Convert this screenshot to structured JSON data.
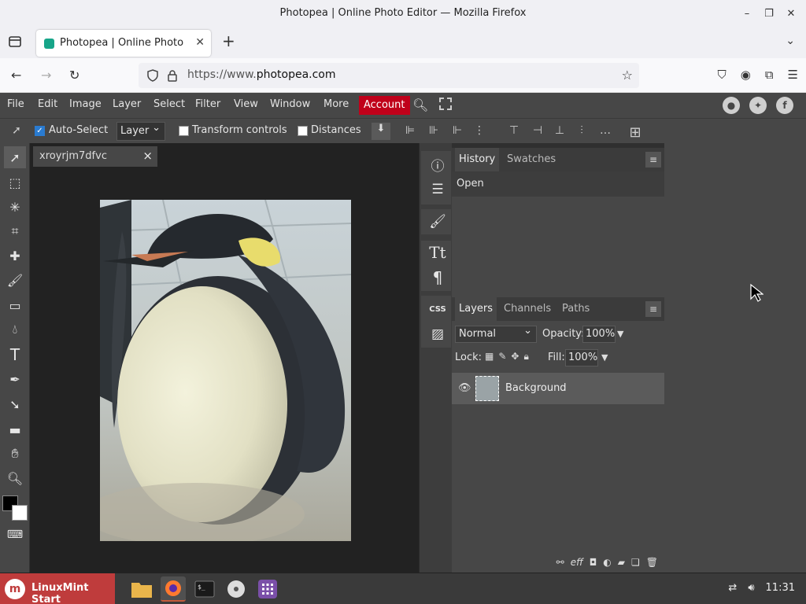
{
  "window": {
    "title": "Photopea | Online Photo Editor — Mozilla Firefox",
    "min_icon": "minimize-icon",
    "max_icon": "restore-icon",
    "close_icon": "close-icon"
  },
  "browser": {
    "tab_title": "Photopea | Online Photo Editor",
    "new_tab_glyph": "+",
    "url_prefix": "https://www.",
    "url_domain": "photopea.com"
  },
  "menu": {
    "items": [
      "File",
      "Edit",
      "Image",
      "Layer",
      "Select",
      "Filter",
      "View",
      "Window",
      "More"
    ],
    "account": "Account"
  },
  "options": {
    "auto_select": "Auto-Select",
    "layer_select": "Layer",
    "transform_controls": "Transform controls",
    "distances": "Distances"
  },
  "document": {
    "tab_name": "xroyrjm7dfvc",
    "close_glyph": "×"
  },
  "side_strip": {
    "css_label": "CSS"
  },
  "history_panel": {
    "tabs": [
      "History",
      "Swatches"
    ],
    "entries": [
      "Open"
    ],
    "menu_glyph": "≡"
  },
  "layers_panel": {
    "tabs": [
      "Layers",
      "Channels",
      "Paths"
    ],
    "blend_mode": "Normal",
    "opacity_label": "Opacity:",
    "opacity_value": "100%",
    "lock_label": "Lock:",
    "fill_label": "Fill:",
    "fill_value": "100%",
    "layers": [
      {
        "name": "Background"
      }
    ],
    "menu_glyph": "≡"
  },
  "taskbar": {
    "start_label": "LinuxMint Start",
    "time": "11:31"
  },
  "colors": {
    "accent_account": "#c0001a",
    "panel": "#474747",
    "workspace": "#222222",
    "mint_red": "#bf3c3c"
  }
}
